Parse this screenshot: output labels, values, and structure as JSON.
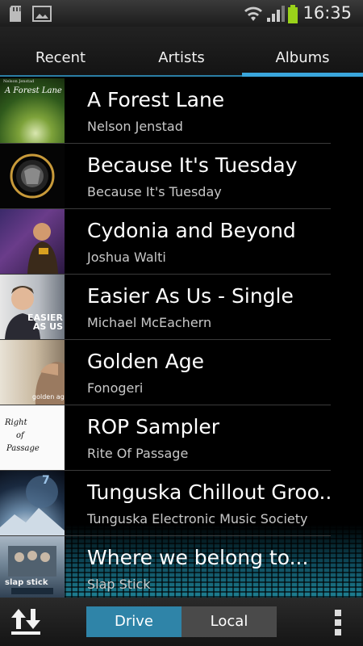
{
  "status_bar": {
    "time": "16:35"
  },
  "tabs": [
    {
      "label": "Recent",
      "selected": false
    },
    {
      "label": "Artists",
      "selected": false
    },
    {
      "label": "Albums",
      "selected": true
    }
  ],
  "albums": [
    {
      "title": "A Forest Lane",
      "artist": "Nelson Jenstad",
      "cover_text": "A Forest Lane",
      "cover_subtext": "Nelson Jenstad"
    },
    {
      "title": "Because It's Tuesday",
      "artist": "Because It's Tuesday"
    },
    {
      "title": "Cydonia and Beyond",
      "artist": "Joshua Walti"
    },
    {
      "title": "Easier As Us - Single",
      "artist": "Michael McEachern",
      "cover_text": "EASIER AS US"
    },
    {
      "title": "Golden Age",
      "artist": "Fonogeri",
      "cover_text": "golden age"
    },
    {
      "title": "ROP Sampler",
      "artist": "Rite Of Passage",
      "cover_text": [
        "Right",
        "of",
        "Passage"
      ]
    },
    {
      "title": "Tunguska Chillout Groo..",
      "artist": "Tunguska Electronic Music Society",
      "cover_text": "7"
    },
    {
      "title": "Where we belong to...",
      "artist": "Slap Stick",
      "cover_text": "slap stick"
    }
  ],
  "bottom_bar": {
    "drive_label": "Drive",
    "local_label": "Local",
    "active_source": "Drive",
    "upload_icon": "upload-download-icon",
    "menu_icon": "overflow-menu-icon"
  },
  "colors": {
    "accent": "#3aa6dc",
    "drive_active": "#2f84a8",
    "local_inactive": "#4a4a4a"
  }
}
